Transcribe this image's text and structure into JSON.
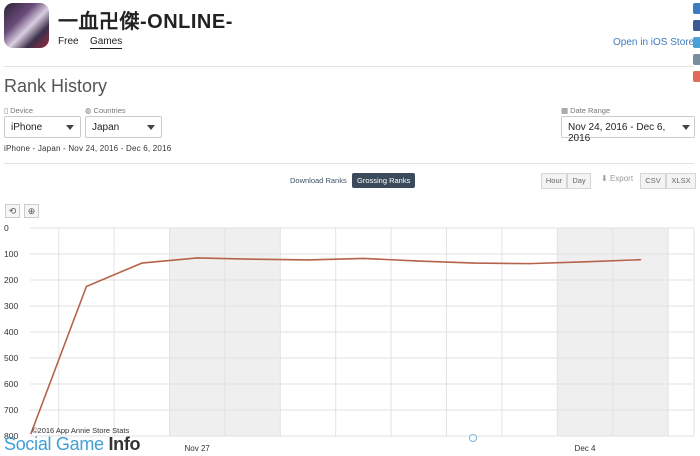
{
  "app": {
    "name": "一血卍傑-ONLINE-",
    "price": "Free",
    "category": "Games",
    "open_link": "Open in iOS Store"
  },
  "page_title": "Rank History",
  "filters": {
    "device_label": "Device",
    "device_value": "iPhone",
    "countries_label": "Countries",
    "countries_value": "Japan",
    "date_range_label": "Date Range",
    "date_range_value": "Nov 24, 2016 - Dec 6, 2016"
  },
  "summary": "iPhone - Japan - Nov 24, 2016 - Dec 6, 2016",
  "rank_tabs": {
    "download": "Download Ranks",
    "grossing": "Grossing Ranks",
    "active": "grossing"
  },
  "granularity": {
    "hour": "Hour",
    "day": "Day",
    "selected": "Day"
  },
  "export": {
    "label": "Export",
    "csv": "CSV",
    "xlsx": "XLSX"
  },
  "colors": {
    "line": "#b5634a",
    "shade": "#efefef",
    "grid": "#e2e2e2",
    "active_tab": "#3b4a5a"
  },
  "chart_data": {
    "type": "line",
    "x": [
      "2016-11-24",
      "2016-11-25",
      "2016-11-26",
      "2016-11-27",
      "2016-11-28",
      "2016-11-29",
      "2016-11-30",
      "2016-12-01",
      "2016-12-02",
      "2016-12-03",
      "2016-12-04",
      "2016-12-05",
      "2016-12-06"
    ],
    "x_tick_labels": {
      "2016-11-27": "Nov 27",
      "2016-12-04": "Dec 4"
    },
    "series": [
      {
        "values": [
          790,
          225,
          135,
          115,
          120,
          123,
          117,
          127,
          135,
          137,
          130,
          122,
          null
        ]
      }
    ],
    "ylim": [
      0,
      800
    ],
    "yticks": [
      0,
      100,
      200,
      300,
      400,
      500,
      600,
      700,
      800
    ],
    "y_inverted": true,
    "shaded_weekends": [
      [
        "2016-11-26",
        "2016-11-27"
      ],
      [
        "2016-12-03",
        "2016-12-04"
      ]
    ],
    "grid": true
  },
  "footer": {
    "credit": "©2016 App Annie Store Stats",
    "watermark_prefix": "Social Game ",
    "watermark_bold": "Info"
  }
}
